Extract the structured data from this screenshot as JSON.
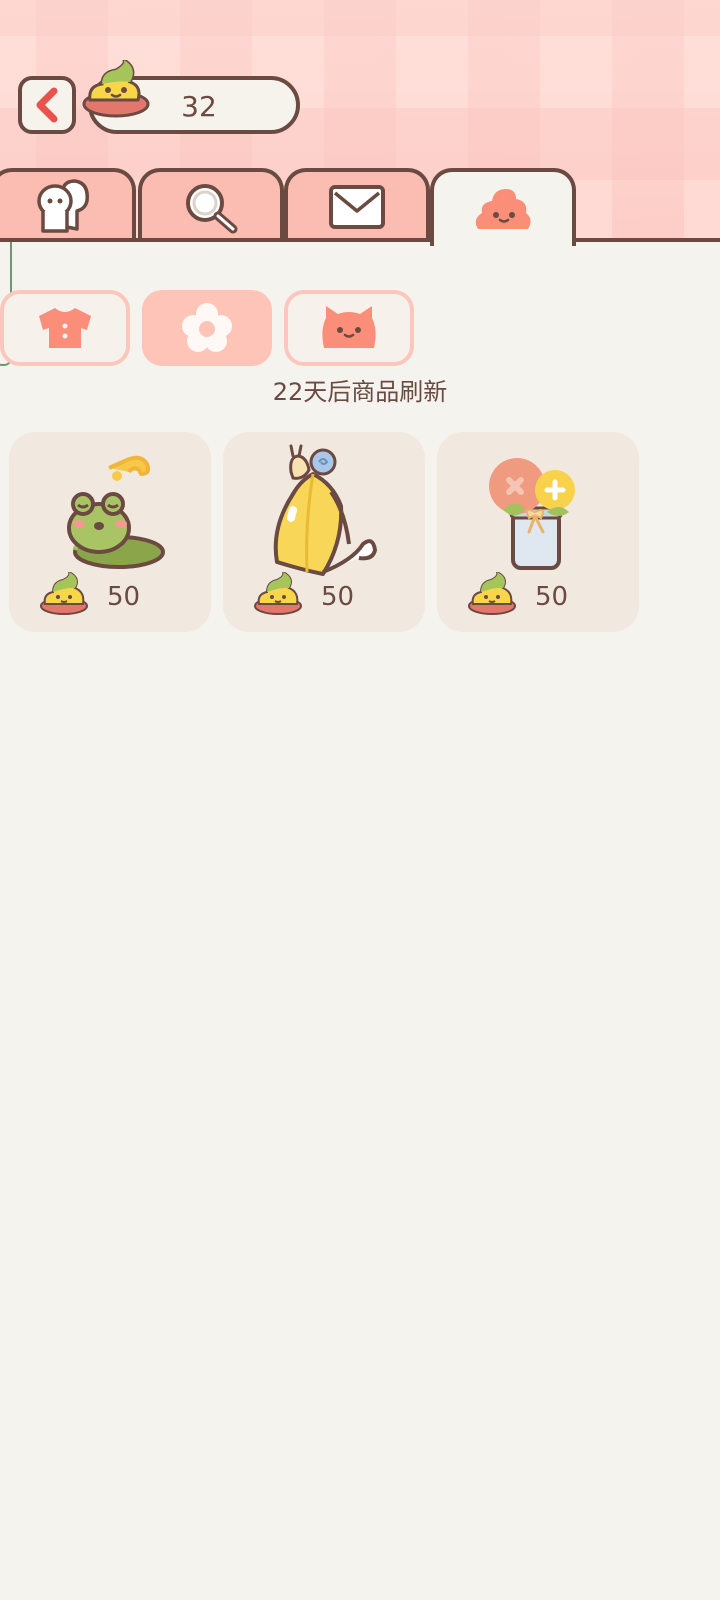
{
  "header": {
    "back_icon": "chevron-left-icon",
    "coin_count": "32",
    "coin_icon": "poop-coin-icon"
  },
  "tabs": [
    {
      "icon": "friends-icon",
      "active": false
    },
    {
      "icon": "search-icon",
      "active": false
    },
    {
      "icon": "mail-icon",
      "active": false
    },
    {
      "icon": "poop-shop-icon",
      "active": true
    }
  ],
  "categories": [
    {
      "icon": "shirt-icon",
      "active": false
    },
    {
      "icon": "flower-icon",
      "active": true
    },
    {
      "icon": "cat-icon",
      "active": false
    }
  ],
  "shop": {
    "refresh_text": "22天后商品刷新",
    "items": [
      {
        "art": "frog-on-lily-pad-icon",
        "price": "50"
      },
      {
        "art": "yellow-umbrella-with-snail-icon",
        "price": "50"
      },
      {
        "art": "flower-jar-icon",
        "price": "50"
      }
    ]
  },
  "colors": {
    "outline": "#6b4a42",
    "tab_pink": "#fbbdb1",
    "accent_coral": "#fa8e79",
    "background": "#f5f3ee",
    "card": "#f1e9df"
  }
}
